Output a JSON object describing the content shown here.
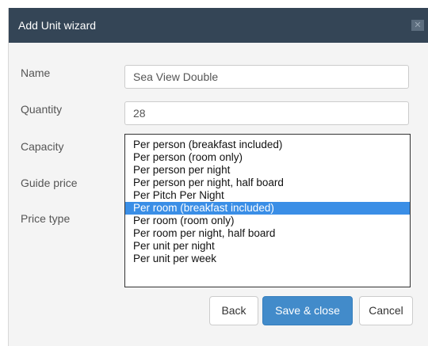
{
  "dialog": {
    "title": "Add Unit wizard",
    "close_glyph": "✕"
  },
  "form": {
    "name_label": "Name",
    "name_value": "Sea View Double",
    "quantity_label": "Quantity",
    "quantity_value": "28",
    "capacity_label": "Capacity",
    "guide_price_label": "Guide price",
    "price_type_label": "Price type"
  },
  "price_type_options": [
    "Per person (breakfast included)",
    "Per person (room only)",
    "Per person per night",
    "Per person per night, half board",
    "Per Pitch Per Night",
    "Per room (breakfast included)",
    "Per room (room only)",
    "Per room per night, half board",
    "Per unit per night",
    "Per unit per week"
  ],
  "price_type_selected": "Per room (breakfast included)",
  "buttons": {
    "back": "Back",
    "save_close": "Save & close",
    "cancel": "Cancel"
  },
  "colors": {
    "titlebar": "#344556",
    "selected_option": "#3a8ee6",
    "primary_button": "#428bca"
  }
}
